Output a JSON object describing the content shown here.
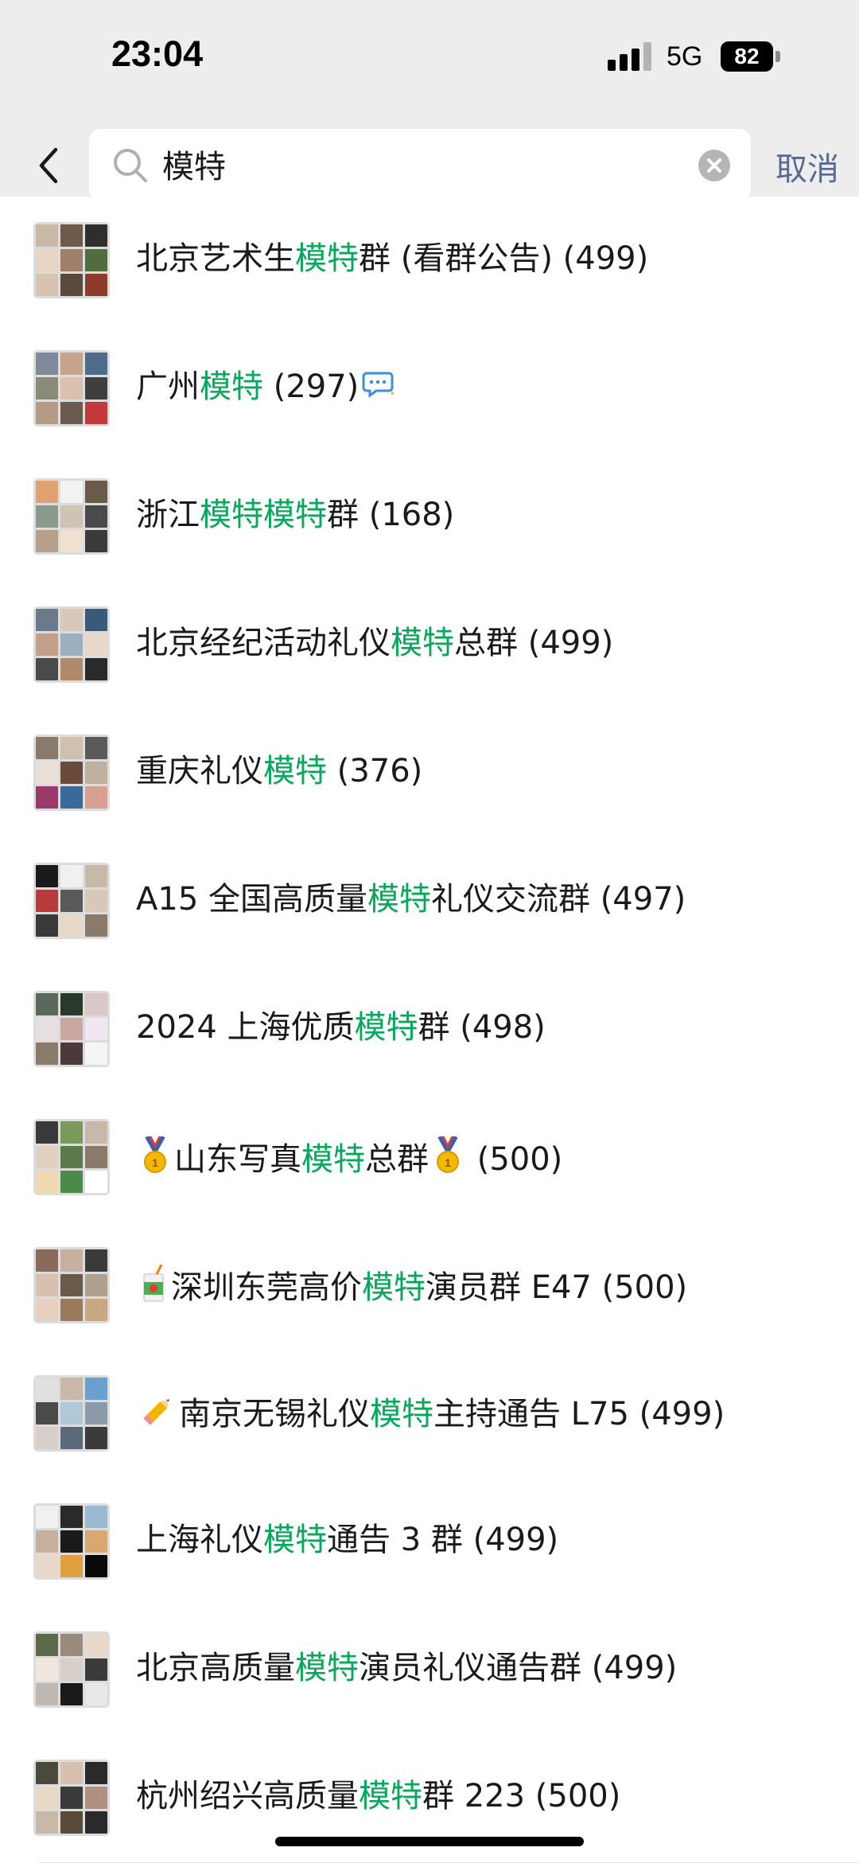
{
  "status_bar": {
    "time": "23:04",
    "network": "5G",
    "battery": "82"
  },
  "search": {
    "query": "模特",
    "cancel_label": "取消"
  },
  "colors": {
    "highlight": "#07a85a",
    "cancel": "#576b95",
    "header_bg": "#ededed"
  },
  "results": [
    {
      "prefix": "北京艺术生",
      "keyword": "模特",
      "suffix": "群 (看群公告) (499)",
      "emoji_before": "",
      "emoji_after": ""
    },
    {
      "prefix": "广州",
      "keyword": "模特",
      "suffix": " (297)",
      "emoji_before": "",
      "emoji_after": "chat-bubble-icon"
    },
    {
      "prefix": "浙江",
      "keyword": "模特模特",
      "suffix": "群 (168)",
      "emoji_before": "",
      "emoji_after": ""
    },
    {
      "prefix": "北京经纪活动礼仪",
      "keyword": "模特",
      "suffix": "总群 (499)",
      "emoji_before": "",
      "emoji_after": ""
    },
    {
      "prefix": "重庆礼仪",
      "keyword": "模特",
      "suffix": " (376)",
      "emoji_before": "",
      "emoji_after": ""
    },
    {
      "prefix": "A15 全国高质量",
      "keyword": "模特",
      "suffix": "礼仪交流群 (497)",
      "emoji_before": "",
      "emoji_after": ""
    },
    {
      "prefix": "2024 上海优质",
      "keyword": "模特",
      "suffix": "群 (498)",
      "emoji_before": "",
      "emoji_after": ""
    },
    {
      "prefix": "山东写真",
      "keyword": "模特",
      "suffix": "总群",
      "count": "(500)",
      "emoji_before": "medal-icon",
      "emoji_after": "medal-icon"
    },
    {
      "prefix": "深圳东莞高价",
      "keyword": "模特",
      "suffix": "演员群 E47 (500)",
      "emoji_before": "juice-box-icon",
      "emoji_after": ""
    },
    {
      "prefix": "南京无锡礼仪",
      "keyword": "模特",
      "suffix": "主持通告 L75 (499)",
      "emoji_before": "pencil-icon",
      "emoji_after": ""
    },
    {
      "prefix": "上海礼仪",
      "keyword": "模特",
      "suffix": "通告 3 群 (499)",
      "emoji_before": "",
      "emoji_after": ""
    },
    {
      "prefix": "北京高质量",
      "keyword": "模特",
      "suffix": "演员礼仪通告群 (499)",
      "emoji_before": "",
      "emoji_after": ""
    },
    {
      "prefix": "杭州绍兴高质量",
      "keyword": "模特",
      "suffix": "群 223 (500)",
      "emoji_before": "",
      "emoji_after": ""
    }
  ]
}
